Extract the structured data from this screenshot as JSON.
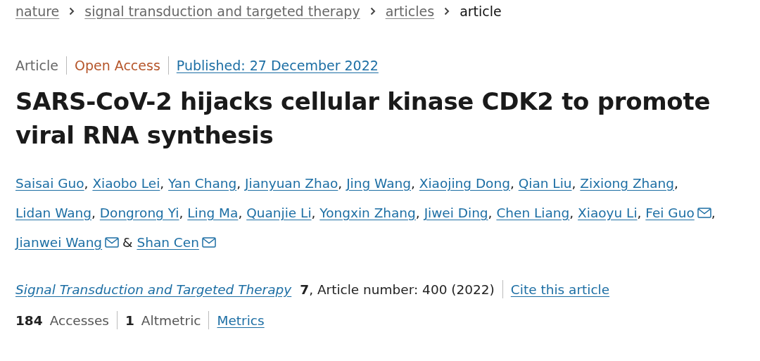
{
  "breadcrumbs": [
    {
      "label": "nature",
      "link": true
    },
    {
      "label": "signal transduction and targeted therapy",
      "link": true
    },
    {
      "label": "articles",
      "link": true
    },
    {
      "label": "article",
      "link": false
    }
  ],
  "article_type": "Article",
  "access": "Open Access",
  "published": "Published: 27 December 2022",
  "title": "SARS-CoV-2 hijacks cellular kinase CDK2 to promote viral RNA synthesis",
  "authors": [
    {
      "name": "Saisai Guo",
      "email": false,
      "separator": ","
    },
    {
      "name": "Xiaobo Lei",
      "email": false,
      "separator": ","
    },
    {
      "name": "Yan Chang",
      "email": false,
      "separator": ","
    },
    {
      "name": "Jianyuan Zhao",
      "email": false,
      "separator": ","
    },
    {
      "name": "Jing Wang",
      "email": false,
      "separator": ","
    },
    {
      "name": "Xiaojing Dong",
      "email": false,
      "separator": ","
    },
    {
      "name": "Qian Liu",
      "email": false,
      "separator": ","
    },
    {
      "name": "Zixiong Zhang",
      "email": false,
      "separator": ","
    },
    {
      "name": "Lidan Wang",
      "email": false,
      "separator": ","
    },
    {
      "name": "Dongrong Yi",
      "email": false,
      "separator": ","
    },
    {
      "name": "Ling Ma",
      "email": false,
      "separator": ","
    },
    {
      "name": "Quanjie Li",
      "email": false,
      "separator": ","
    },
    {
      "name": "Yongxin Zhang",
      "email": false,
      "separator": ","
    },
    {
      "name": "Jiwei Ding",
      "email": false,
      "separator": ","
    },
    {
      "name": "Chen Liang",
      "email": false,
      "separator": ","
    },
    {
      "name": "Xiaoyu Li",
      "email": false,
      "separator": ","
    },
    {
      "name": "Fei Guo",
      "email": true,
      "separator": ","
    },
    {
      "name": "Jianwei Wang",
      "email": true,
      "separator": "&"
    },
    {
      "name": "Shan Cen",
      "email": true
    }
  ],
  "citation": {
    "journal": "Signal Transduction and Targeted Therapy",
    "volume": "7",
    "details": ", Article number: 400 (2022)",
    "cite": "Cite this article"
  },
  "metrics": [
    {
      "count": "184",
      "name": "Accesses"
    },
    {
      "count": "1",
      "name": "Altmetric"
    }
  ],
  "metrics_link": "Metrics"
}
